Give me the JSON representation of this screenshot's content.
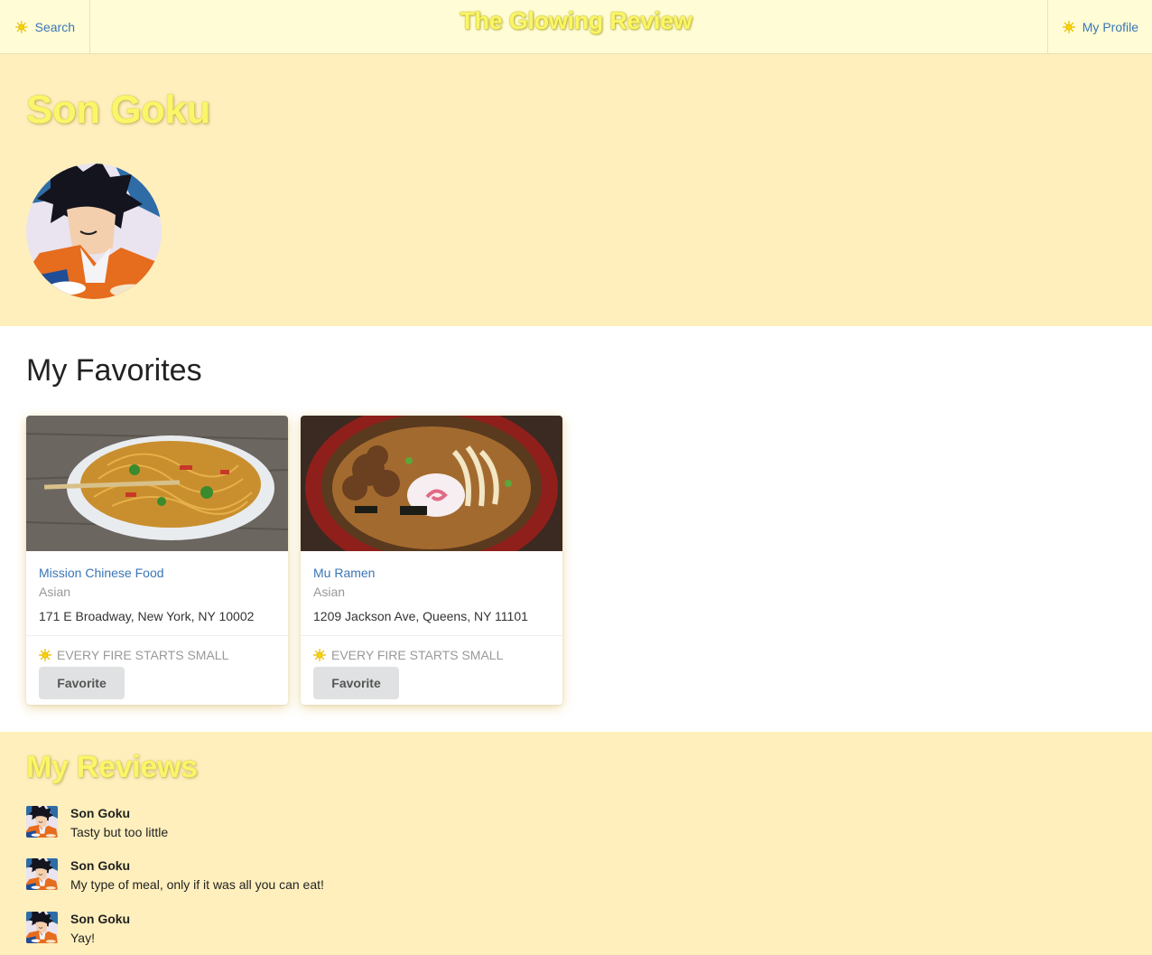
{
  "nav": {
    "search_label": "Search",
    "brand": "The Glowing Review",
    "profile_label": "My Profile"
  },
  "profile": {
    "name": "Son Goku"
  },
  "favorites": {
    "title": "My Favorites",
    "cards": [
      {
        "name": "Mission Chinese Food",
        "category": "Asian",
        "address": "171 E Broadway, New York, NY 10002",
        "motto": "EVERY FIRE STARTS SMALL",
        "button": "Favorite"
      },
      {
        "name": "Mu Ramen",
        "category": "Asian",
        "address": "1209 Jackson Ave, Queens, NY 11101",
        "motto": "EVERY FIRE STARTS SMALL",
        "button": "Favorite"
      }
    ]
  },
  "reviews": {
    "title": "My Reviews",
    "items": [
      {
        "author": "Son Goku",
        "text": "Tasty but too little"
      },
      {
        "author": "Son Goku",
        "text": "My type of meal, only if it was all you can eat!"
      },
      {
        "author": "Son Goku",
        "text": "Yay!"
      }
    ]
  },
  "colors": {
    "page_bg": "#ffefbd",
    "nav_bg": "#fffcd6",
    "glow_text": "#fbf56a",
    "link": "#3a76b6",
    "sun_icon": "#f2c200"
  },
  "icons": [
    "sun-icon"
  ]
}
